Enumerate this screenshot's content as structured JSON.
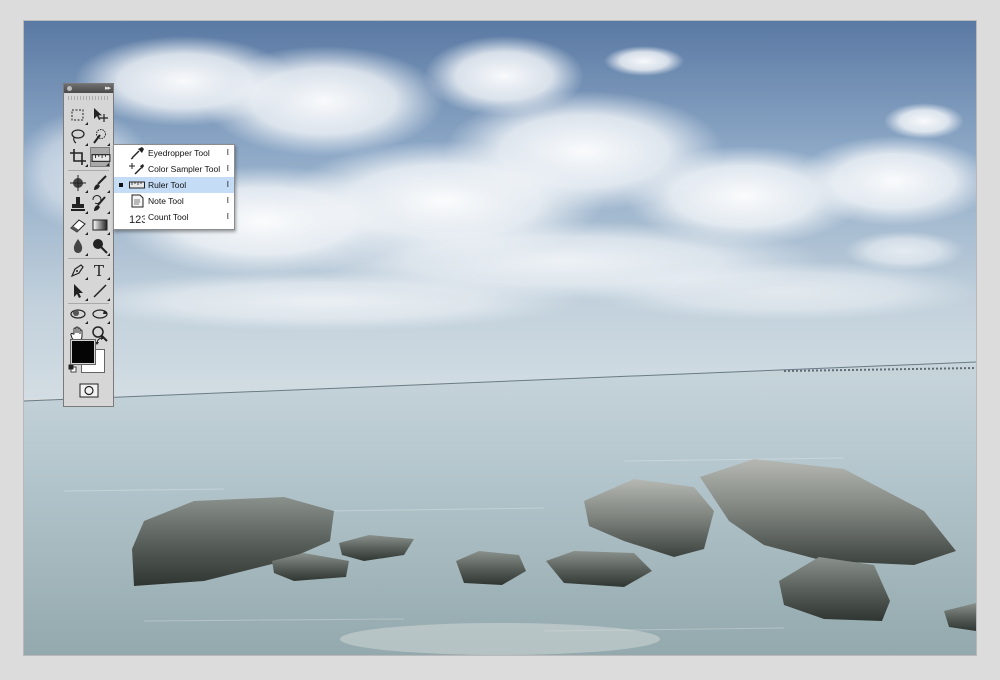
{
  "toolbox": {
    "tools": [
      {
        "name": "rectangular-marquee-tool-icon"
      },
      {
        "name": "move-tool-icon"
      },
      {
        "name": "lasso-tool-icon"
      },
      {
        "name": "quick-selection-tool-icon"
      },
      {
        "name": "crop-tool-icon"
      },
      {
        "name": "ruler-tool-icon",
        "active": true
      },
      {
        "name": "spot-healing-brush-tool-icon"
      },
      {
        "name": "brush-tool-icon"
      },
      {
        "name": "clone-stamp-tool-icon"
      },
      {
        "name": "history-brush-tool-icon"
      },
      {
        "name": "eraser-tool-icon"
      },
      {
        "name": "gradient-tool-icon"
      },
      {
        "name": "blur-tool-icon"
      },
      {
        "name": "dodge-tool-icon"
      },
      {
        "name": "pen-tool-icon"
      },
      {
        "name": "type-tool-icon"
      },
      {
        "name": "path-selection-tool-icon"
      },
      {
        "name": "line-tool-icon"
      },
      {
        "name": "3d-rotate-tool-icon"
      },
      {
        "name": "3d-orbit-tool-icon"
      },
      {
        "name": "hand-tool-icon"
      },
      {
        "name": "zoom-tool-icon"
      }
    ],
    "type_tool_glyph": "T",
    "foreground_color": "#050505",
    "background_color": "#ffffff"
  },
  "flyout": {
    "items": [
      {
        "label": "Eyedropper Tool",
        "shortcut": "I",
        "icon": "eyedropper-icon",
        "selected": false
      },
      {
        "label": "Color Sampler Tool",
        "shortcut": "I",
        "icon": "color-sampler-icon",
        "selected": false
      },
      {
        "label": "Ruler Tool",
        "shortcut": "I",
        "icon": "ruler-icon",
        "selected": true
      },
      {
        "label": "Note Tool",
        "shortcut": "I",
        "icon": "note-icon",
        "selected": false
      },
      {
        "label": "Count Tool",
        "shortcut": "I",
        "icon": "count-icon",
        "selected": false
      }
    ],
    "count_icon_glyph": "123",
    "selection_color": "#c4dcf5"
  },
  "photo": {
    "sky_top": "#5c7ca6",
    "sky_horizon": "#c9d6df",
    "sea": "#a9bcc4",
    "rock": "#4e5550"
  }
}
